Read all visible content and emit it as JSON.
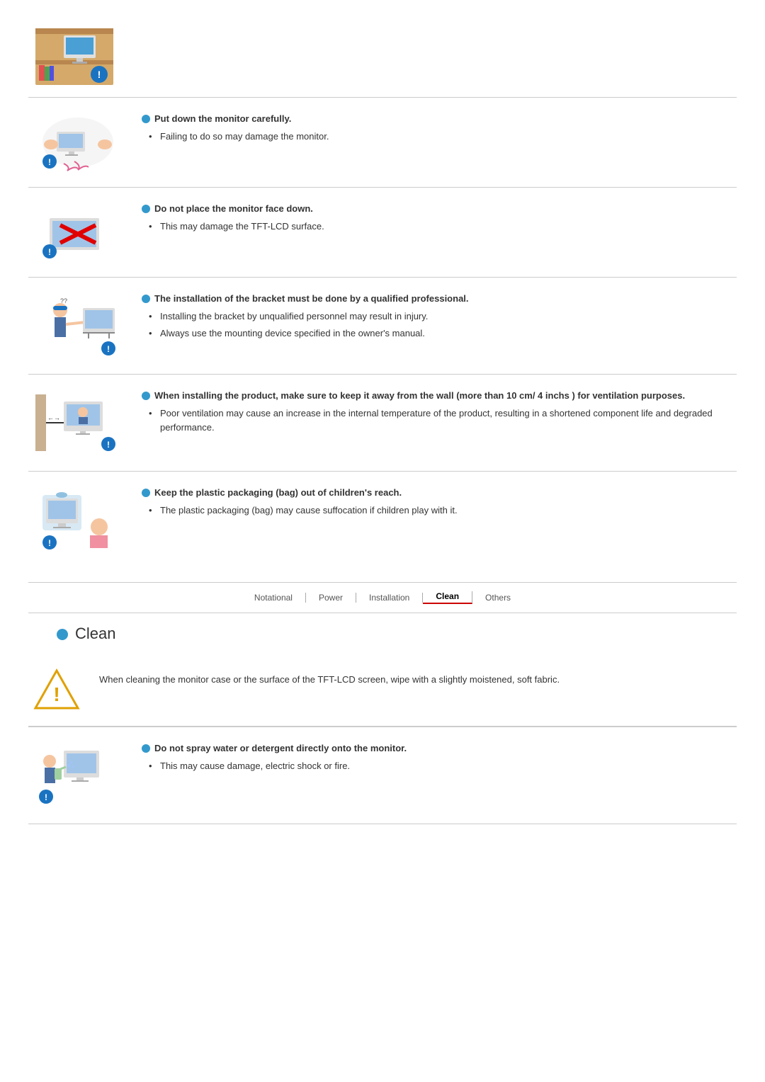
{
  "topImage": {
    "alt": "monitor on shelf illustration"
  },
  "sections": [
    {
      "id": "put-down",
      "title": "Put down the monitor carefully.",
      "bullets": [
        "Failing to do so may damage the monitor."
      ],
      "imgAlt": "put down monitor illustration"
    },
    {
      "id": "face-down",
      "title": "Do not place the monitor face down.",
      "bullets": [
        "This may damage the TFT-LCD surface."
      ],
      "imgAlt": "face down warning illustration"
    },
    {
      "id": "bracket",
      "title": "The installation of the bracket must be done by a qualified professional.",
      "bullets": [
        "Installing the bracket by unqualified personnel may result in injury.",
        "Always use the mounting device specified in the owner's manual."
      ],
      "imgAlt": "bracket installation illustration"
    },
    {
      "id": "ventilation",
      "title": "When installing the product, make sure to keep it away from the wall (more than 10 cm/ 4 inchs ) for ventilation purposes.",
      "bullets": [
        "Poor ventilation may cause an increase in the internal temperature of the product, resulting in a shortened component life and degraded performance."
      ],
      "imgAlt": "ventilation illustration"
    },
    {
      "id": "packaging",
      "title": "Keep the plastic packaging (bag) out of children's reach.",
      "bullets": [
        "The plastic packaging (bag) may cause suffocation if children play with it."
      ],
      "imgAlt": "packaging child safety illustration"
    }
  ],
  "nav": {
    "items": [
      "Notational",
      "Power",
      "Installation",
      "Clean",
      "Others"
    ],
    "active": "Clean"
  },
  "cleanSection": {
    "heading": "Clean",
    "cleaningText": "When cleaning the monitor case or the surface of the TFT-LCD screen, wipe with a slightly moistened, soft fabric.",
    "doNotSpray": {
      "title": "Do not spray water or detergent directly onto the monitor.",
      "bullets": [
        "This may cause damage, electric shock or fire."
      ]
    }
  }
}
